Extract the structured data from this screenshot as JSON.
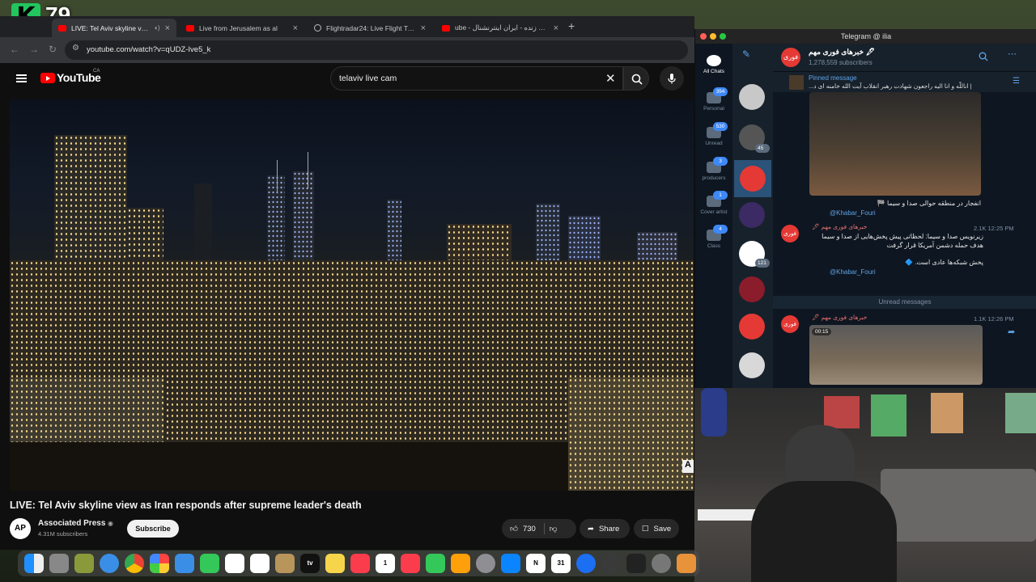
{
  "overlay": {
    "count": "79",
    "logo_letter": "K"
  },
  "browser": {
    "tabs": [
      {
        "title": "LIVE: Tel Aviv skyline view"
      },
      {
        "title": "Live from Jerusalem as al"
      },
      {
        "title": "Flightradar24: Live Flight Trac"
      },
      {
        "title": "ube - پخش زنده - ایران اینترنشنال"
      }
    ],
    "url": "youtube.com/watch?v=qUDZ-Ive5_k"
  },
  "youtube": {
    "logo_text": "YouTube",
    "region": "CA",
    "search_query": "telaviv live cam",
    "video_title": "LIVE: Tel Aviv skyline view as Iran responds after supreme leader's death",
    "channel_initials": "AP",
    "channel_name": "Associated Press",
    "channel_subs": "4.31M subscribers",
    "subscribe_label": "Subscribe",
    "likes": "730",
    "share_label": "Share",
    "save_label": "Save",
    "video_corner_text": "A"
  },
  "telegram": {
    "window_title": "Telegram @ ilia",
    "folders": [
      {
        "label": "All Chats",
        "badge": ""
      },
      {
        "label": "Personal",
        "badge": "394"
      },
      {
        "label": "Unread",
        "badge": "530"
      },
      {
        "label": "producers",
        "badge": "3"
      },
      {
        "label": "Cover artist",
        "badge": "1"
      },
      {
        "label": "Class",
        "badge": "4"
      }
    ],
    "chat_badges": {
      "chat3": "45",
      "chat7": "121"
    },
    "channel_name": "خبرهای فوری مهم 🖋",
    "channel_avatar_text": "فوری",
    "channel_subs": "1,278,559 subscribers",
    "pinned_label": "Pinned message",
    "pinned_text": "| اناللّه و انا الیه راجعون شهادت رهبر انقلاب آیت الله خامنه ای د...",
    "msg1_caption": "انفجار در منطقه حوالی صدا و سیما 🏁",
    "msg_link": "@Khabar_Fouri",
    "msg2_sender": "خبرهای فوری مهم 🖋",
    "msg2_meta": "2.1K 12:25 PM",
    "msg2_text_line1": "زیرنویس صدا و سیما: لحظاتی پیش پخش‌هایی از صدا و سیما",
    "msg2_text_line2": "هدف حمله دشمن آمریکا قرار گرفت",
    "msg2_text_line3": "پخش شبکه‌ها عادی است. 🔷",
    "unread_label": "Unread messages",
    "msg3_sender": "خبرهای فوری مهم 🖋",
    "msg3_meta": "1.1K 12:26 PM",
    "msg3_duration": "00:15"
  },
  "dock": {
    "apps": [
      "finder",
      "launchpad",
      "system-preferences",
      "safari",
      "chrome",
      "photos",
      "mail",
      "facetime",
      "reminders",
      "freeform",
      "notes-folder",
      "apple-tv",
      "notes",
      "music",
      "calendar",
      "news",
      "numbers",
      "pages",
      "settings",
      "app-store",
      "notion",
      "calendar-31",
      "xcode",
      "instruments",
      "unity",
      "disk-utility",
      "logic"
    ],
    "calendar_label": "1",
    "notion_label": "N",
    "date_label": "31",
    "tv_label": "tv"
  },
  "colors": {
    "youtube_red": "#ff0000",
    "telegram_blue": "#5ea5e8",
    "kick_green": "#22c55e"
  }
}
